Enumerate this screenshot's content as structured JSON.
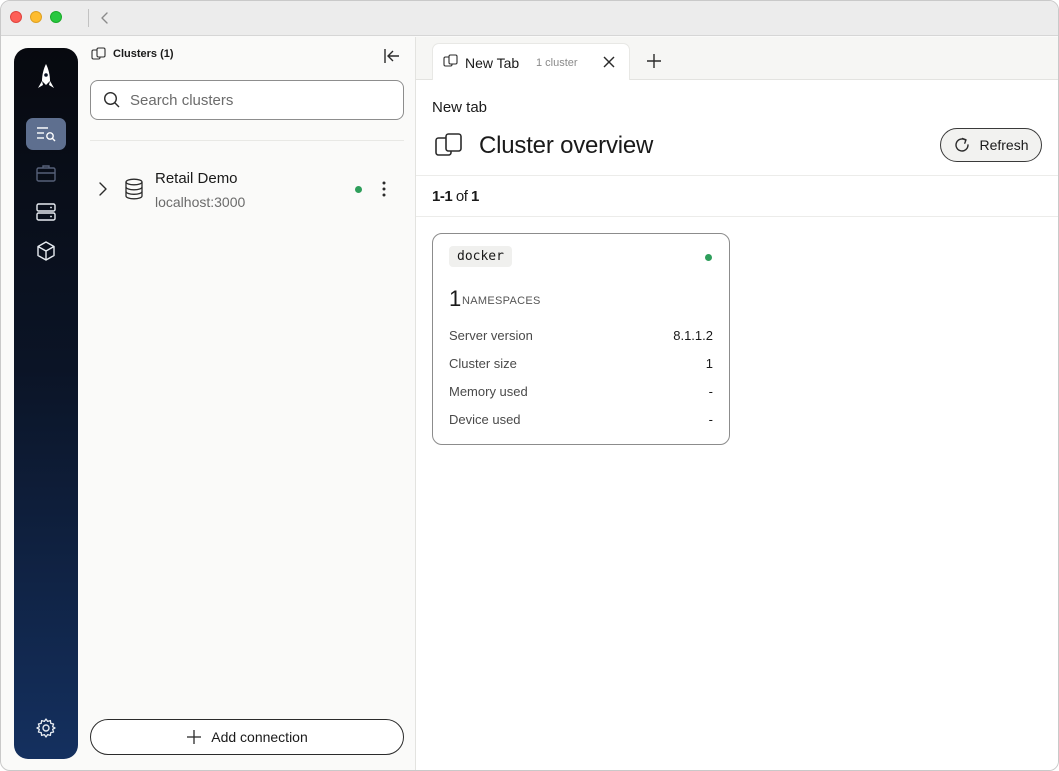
{
  "left_panel": {
    "header": "Clusters (1)",
    "search_placeholder": "Search clusters",
    "clusters": [
      {
        "name": "Retail Demo",
        "host": "localhost:3000",
        "status_color": "#2e9e5b"
      }
    ],
    "add_connection_label": "Add connection"
  },
  "tabs": [
    {
      "title": "New Tab",
      "subtitle": "1 cluster"
    }
  ],
  "main": {
    "breadcrumb": "New tab",
    "title": "Cluster overview",
    "refresh_label": "Refresh",
    "count": {
      "range": "1-1",
      "of_word": "of",
      "total": "1"
    }
  },
  "cards": [
    {
      "name": "docker",
      "status_color": "#2e9e5b",
      "namespaces_count": "1",
      "namespaces_label": "NAMESPACES",
      "rows": [
        {
          "label": "Server version",
          "value": "8.1.1.2"
        },
        {
          "label": "Cluster size",
          "value": "1"
        },
        {
          "label": "Memory used",
          "value": "-"
        },
        {
          "label": "Device used",
          "value": "-"
        }
      ]
    }
  ],
  "rail": {
    "items": [
      "logo-rocket",
      "query-explorer",
      "briefcase",
      "server",
      "cube",
      "settings"
    ],
    "active": "query-explorer"
  },
  "colors": {
    "accent_active": "#5e6f8f",
    "status_ok": "#2e9e5b",
    "rail_top": "#07090f",
    "rail_bottom": "#14305f"
  }
}
